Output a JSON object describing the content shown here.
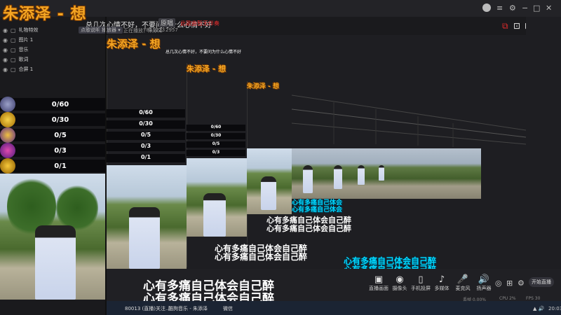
{
  "title": "朱添泽 - 想",
  "lyric_line": "总几次心情不好，不要问为什么心情不好",
  "tag": "原唱",
  "red_text": "此歌曲暂无伴奏",
  "chips": [
    "点歌说明",
    "播放器 ▾"
  ],
  "meta": [
    "正在播放：朱添泽",
    "7851223",
    "2957"
  ],
  "scenes": [
    {
      "label": "礼物特效"
    },
    {
      "label": "图片 1"
    },
    {
      "label": "音乐"
    },
    {
      "label": "歌词"
    },
    {
      "label": "合屏 1"
    }
  ],
  "counts": [
    "0/60",
    "0/30",
    "0/5",
    "0/3",
    "0/1"
  ],
  "big_lyric": "心有多痛自己体会自己醉",
  "small_overlay": [
    "心有多痛自己体会",
    "心有多痛自己体会",
    "心有多痛自己体会",
    "心有多痛自己体会"
  ],
  "bottom_buttons": [
    {
      "label": "直播画面",
      "icon": "▣"
    },
    {
      "label": "摄像头",
      "icon": "◉"
    },
    {
      "label": "手机投屏",
      "icon": "▯"
    },
    {
      "label": "多媒体",
      "icon": "♪"
    },
    {
      "label": "麦克风",
      "icon": "🎤"
    },
    {
      "label": "扬声器",
      "icon": "🔊"
    }
  ],
  "start_live": "开始直播",
  "taskbar": [
    "80013 (直播)关注...",
    "酷狗音乐 - 朱添泽",
    "微信"
  ],
  "status": [
    "丢帧 0.00%",
    "CPU 2%",
    "FPS 30"
  ],
  "clock": "20:03",
  "colors": {
    "accent": "#f5a623",
    "lyric": "#00d8ff",
    "alert": "#e02b2b"
  }
}
